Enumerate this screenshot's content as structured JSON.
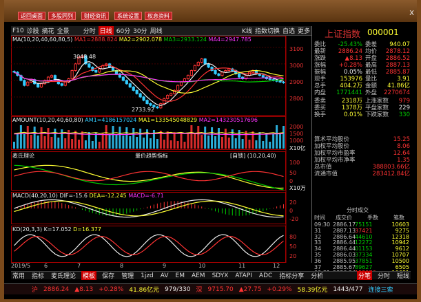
{
  "topbar": {
    "buttons": [
      "返回桌面",
      "多股同列",
      "财经资讯",
      "系统设置",
      "权息资料"
    ],
    "close_glyph": "X"
  },
  "toolbar": {
    "items": [
      "F10",
      "诊股",
      "摘花",
      "全景",
      "分时",
      "日线",
      "60分",
      "30分",
      "周线"
    ],
    "selected": "日线",
    "right_items": [
      "K线",
      "指数切换",
      "自选",
      "更多"
    ]
  },
  "legends": {
    "ma": [
      "MA1=2888.824",
      "MA2=2902.078",
      "MA3=2933.124",
      "MA4=2947.785"
    ],
    "ma_prefix": "MA",
    "ma_params": "(10,20,40,60,80,5)",
    "amount": [
      "AMOUNT",
      "(10,20,40,60,80)",
      "AM1=4186157024",
      "MA1=133545048829",
      "MA2=143230517696"
    ],
    "leader": "麦氏理论",
    "leader_mid": "量价趋势指标",
    "leader_right": "[自锁] (10,20,40)",
    "macd": [
      "MACD",
      "(40,20,10)",
      "DIF=-15.6",
      "DEA=-12.245",
      "MACD=-6.71"
    ],
    "kd": [
      "KD",
      "(20,3,3)",
      "K=17.052",
      "D=16.377"
    ]
  },
  "price_labels": {
    "high": "3048.48",
    "low": "2733.92",
    "axis": [
      "3100",
      "3000",
      "2900",
      "2800"
    ],
    "amt_axis": [
      "2000",
      "1500",
      "1000",
      "500"
    ],
    "amt_unit": "X10亿",
    "leader_axis": [
      "100",
      "50",
      "0"
    ],
    "leader_unit": "X10万",
    "macd_axis": [
      "20",
      "0",
      "-20"
    ],
    "kd_axis": [
      "80",
      "50",
      "20"
    ]
  },
  "dates": [
    "2019/5",
    "6",
    "7",
    "8",
    "9",
    "10",
    "11",
    "12"
  ],
  "right_panel": {
    "title": "上证指数",
    "code": "000001",
    "rows": [
      {
        "l": "委比",
        "v": "-25.43%",
        "vc": "grn",
        "l2": "委差",
        "v2": "940.07",
        "v2c": "yel"
      },
      {
        "l": "最新",
        "v": "2886.24",
        "vc": "red",
        "l2": "均价",
        "v2": "2878.12",
        "v2c": "red"
      },
      {
        "l": "涨跌",
        "v": "▲8.13",
        "vc": "red",
        "l2": "开盘",
        "v2": "2886.52",
        "v2c": "red"
      },
      {
        "l": "涨幅",
        "v": "+0.28%",
        "vc": "red",
        "l2": "最高",
        "v2": "2887.13",
        "v2c": "red"
      },
      {
        "l": "振幅",
        "v": "0.05%",
        "vc": "wht",
        "l2": "最低",
        "v2": "2885.87",
        "v2c": "red"
      },
      {
        "l": "现手",
        "v": "153976",
        "vc": "yel",
        "l2": "量比",
        "v2": "3.91",
        "v2c": "yel"
      },
      {
        "l": "总手",
        "v": "404.2万",
        "vc": "yel",
        "l2": "金额",
        "v2": "41.86亿",
        "v2c": "yel"
      },
      {
        "l": "内盘",
        "v": "1771441",
        "vc": "grn",
        "l2": "外盘",
        "v2": "2270674",
        "v2c": "red"
      },
      {
        "l": "委卖",
        "v": "2318万",
        "vc": "yel",
        "l2": "上涨家数",
        "v2": "979",
        "v2c": "red"
      },
      {
        "l": "委买",
        "v": "1378万",
        "vc": "yel",
        "l2": "平盘家数",
        "v2": "229",
        "v2c": "wht"
      },
      {
        "l": "换手",
        "v": "0.01%",
        "vc": "yel",
        "l2": "下跌家数",
        "v2": "330",
        "v2c": "grn"
      }
    ],
    "stats": [
      {
        "l": "算术平均股价",
        "v": "15.25"
      },
      {
        "l": "加权平均股价",
        "v": "8.06"
      },
      {
        "l": "加权平均市盈率",
        "v": "12.64"
      },
      {
        "l": "加权平均市净率",
        "v": "1.35"
      },
      {
        "l": "总市值",
        "v": "388803.66亿"
      },
      {
        "l": "流通市值",
        "v": "283412.84亿"
      }
    ],
    "trades_title": "分时成交",
    "trades_head": [
      "时间",
      "成交价",
      "手数",
      "笔数"
    ],
    "trades": [
      {
        "t": "09:30",
        "p": "2886.17",
        "vol": "75151",
        "dir": "down",
        "amt": "10603"
      },
      {
        "t": "31",
        "p": "2887.13",
        "vol": "37421",
        "dir": "up",
        "amt": "9275"
      },
      {
        "t": "32",
        "p": "2886.64",
        "vol": "44610",
        "dir": "down",
        "amt": "12318"
      },
      {
        "t": "33",
        "p": "2886.44",
        "vol": "12272",
        "dir": "down",
        "amt": "10942"
      },
      {
        "t": "34",
        "p": "2886.44",
        "vol": "01153",
        "dir": "down",
        "amt": "9612"
      },
      {
        "t": "35",
        "p": "2886.03",
        "vol": "37334",
        "dir": "down",
        "amt": "10707"
      },
      {
        "t": "36",
        "p": "2885.95",
        "vol": "37851",
        "dir": "down",
        "amt": "10500"
      },
      {
        "t": "37",
        "p": "2885.67",
        "vol": "89627",
        "dir": "down",
        "amt": "6505"
      },
      {
        "t": "09:31",
        "p": "2886.24",
        "vol": "153976",
        "dir": "up",
        "amt": "10681"
      }
    ]
  },
  "tabs": [
    "常用",
    "指标",
    "麦氏理论",
    "模板",
    "保存",
    "管理",
    "1jzd",
    "AV",
    "EM",
    "AEM",
    "SDYX",
    "ATAPI",
    "ADC",
    "指标分享",
    "分析"
  ],
  "active_tab": "模板",
  "tabs_right": [
    "分笔",
    "分时",
    "短线"
  ],
  "status": {
    "label": "沪",
    "price": "2886.24",
    "change": "▲8.13",
    "pct": "+0.28%",
    "amount": "41.86亿元",
    "counts": "979/330",
    "shen_label": "深",
    "shen_price": "9715.70",
    "shen_change": "▲27.75",
    "shen_pct": "+0.29%",
    "shen_amt": "58.39亿元",
    "shen_counts": "1443/477",
    "conn": "连接三索"
  },
  "chart_data": {
    "type": "candlestick",
    "x": [
      "2019/5",
      "6",
      "7",
      "8",
      "9",
      "10",
      "11",
      "12"
    ],
    "ylim": [
      2700,
      3120
    ],
    "close": [
      2950,
      2930,
      2900,
      2870,
      2890,
      2905,
      2880,
      2860,
      2880,
      2900,
      2920,
      2930,
      2900,
      2880,
      2870,
      2890,
      2910,
      2960,
      3000,
      3040,
      3048,
      3000,
      2980,
      2960,
      2950,
      2970,
      2990,
      3000,
      2980,
      2960,
      2940,
      2920,
      2900,
      2880,
      2860,
      2840,
      2820,
      2800,
      2780,
      2760,
      2750,
      2740,
      2734,
      2760,
      2790,
      2810,
      2820,
      2840,
      2870,
      2890,
      2910,
      2930,
      2960,
      2990,
      3010,
      3030,
      3000,
      2980,
      2960,
      2940,
      2930,
      2950,
      2960,
      2970,
      2960,
      2940,
      2920,
      2910,
      2930,
      2950,
      2960,
      2940,
      2930,
      2920,
      2910,
      2905,
      2900,
      2895,
      2890,
      2886
    ]
  }
}
